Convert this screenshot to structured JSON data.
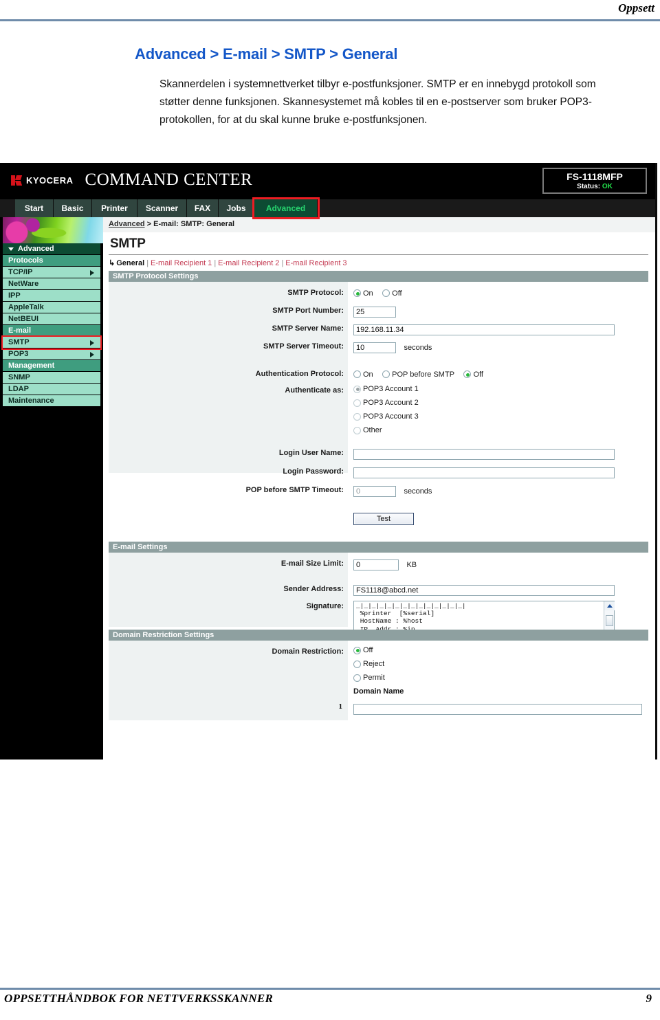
{
  "document": {
    "header_label": "Oppsett",
    "title": "Advanced > E-mail > SMTP > General",
    "body": "Skannerdelen i systemnettverket tilbyr e-postfunksjoner. SMTP er en innebygd protokoll som støtter denne funksjonen. Skannesystemet må kobles til en e-postserver som bruker POP3-protokollen, for at du skal kunne bruke e-postfunksjonen.",
    "footer_text": "OPPSETTHÅNDBOK FOR NETTVERKSSKANNER",
    "footer_page": "9"
  },
  "app": {
    "brand": "KYOCERA",
    "product": "COMMAND CENTER",
    "status": {
      "model": "FS-1118MFP",
      "label": "Status:",
      "value": "OK"
    },
    "tabs": [
      {
        "label": "Start",
        "active": false
      },
      {
        "label": "Basic",
        "active": false
      },
      {
        "label": "Printer",
        "active": false
      },
      {
        "label": "Scanner",
        "active": false
      },
      {
        "label": "FAX",
        "active": false
      },
      {
        "label": "Jobs",
        "active": false
      },
      {
        "label": "Advanced",
        "active": true
      }
    ],
    "breadcrumb": {
      "root": "Advanced",
      "separator": ">",
      "path": "E-mail: SMTP: General"
    },
    "colors": {
      "tab_bg": "#30453f",
      "tab_active_bg": "#0d4b33",
      "tab_active_text": "#27d46f",
      "highlight_outline": "#ee1c22",
      "sidebar_group": "#3f9d7f",
      "sidebar_item": "#9ddfc8",
      "section_bar": "#8ea0a0",
      "link": "#c43a52",
      "radio_on": "#27b83c"
    }
  },
  "sidebar": {
    "header": "Advanced",
    "items": [
      {
        "label": "Protocols",
        "type": "group"
      },
      {
        "label": "TCP/IP",
        "type": "item",
        "arrow": true,
        "selected": false
      },
      {
        "label": "NetWare",
        "type": "item",
        "arrow": false,
        "selected": false
      },
      {
        "label": "IPP",
        "type": "item",
        "arrow": false,
        "selected": false
      },
      {
        "label": "AppleTalk",
        "type": "item",
        "arrow": false,
        "selected": false
      },
      {
        "label": "NetBEUI",
        "type": "item",
        "arrow": false,
        "selected": false
      },
      {
        "label": "E-mail",
        "type": "group"
      },
      {
        "label": "SMTP",
        "type": "item",
        "arrow": true,
        "selected": true
      },
      {
        "label": "POP3",
        "type": "item",
        "arrow": true,
        "selected": false
      },
      {
        "label": "Management",
        "type": "group"
      },
      {
        "label": "SNMP",
        "type": "item",
        "arrow": false,
        "selected": false
      },
      {
        "label": "LDAP",
        "type": "item",
        "arrow": false,
        "selected": false
      },
      {
        "label": "Maintenance",
        "type": "item",
        "arrow": false,
        "selected": false
      }
    ]
  },
  "content": {
    "title": "SMTP",
    "subtabs": [
      {
        "label": "General",
        "current": true
      },
      {
        "label": "E-mail Recipient 1",
        "current": false
      },
      {
        "label": "E-mail Recipient 2",
        "current": false
      },
      {
        "label": "E-mail Recipient 3",
        "current": false
      }
    ],
    "sections": {
      "protocol": {
        "bar": "SMTP Protocol Settings",
        "smtp_protocol_label": "SMTP Protocol:",
        "smtp_protocol_options": [
          {
            "label": "On",
            "selected": true
          },
          {
            "label": "Off",
            "selected": false
          }
        ],
        "port_label": "SMTP Port Number:",
        "port_value": "25",
        "server_label": "SMTP Server Name:",
        "server_value": "192.168.11.34",
        "timeout_label": "SMTP Server Timeout:",
        "timeout_value": "10",
        "timeout_unit": "seconds",
        "auth_protocol_label": "Authentication Protocol:",
        "auth_protocol_options": [
          {
            "label": "On",
            "selected": false
          },
          {
            "label": "POP before SMTP",
            "selected": false
          },
          {
            "label": "Off",
            "selected": true
          }
        ],
        "authenticate_as_label": "Authenticate as:",
        "authenticate_as_options": [
          {
            "label": "POP3 Account 1",
            "selected": true
          },
          {
            "label": "POP3 Account 2",
            "selected": false
          },
          {
            "label": "POP3 Account 3",
            "selected": false
          },
          {
            "label": "Other",
            "selected": false
          }
        ],
        "login_user_label": "Login User Name:",
        "login_user_value": "",
        "login_pass_label": "Login Password:",
        "login_pass_value": "",
        "pop_timeout_label": "POP before SMTP Timeout:",
        "pop_timeout_value": "0",
        "pop_timeout_unit": "seconds",
        "test_button": "Test"
      },
      "email": {
        "bar": "E-mail Settings",
        "size_limit_label": "E-mail Size Limit:",
        "size_limit_value": "0",
        "size_limit_unit": "KB",
        "sender_label": "Sender Address:",
        "sender_value": "FS1118@abcd.net",
        "signature_label": "Signature:",
        "signature_value": "_|_|_|_|_|_|_|_|_|_|_|_|_|_|\n %printer  [%serial]\n HostName : %host\n IP  Addr : %ip\n_|_|_|_|_|_|_|_|_|_|_|_|_|"
      },
      "domain": {
        "bar": "Domain Restriction Settings",
        "restriction_label": "Domain Restriction:",
        "restriction_options": [
          {
            "label": "Off",
            "selected": true
          },
          {
            "label": "Reject",
            "selected": false
          },
          {
            "label": "Permit",
            "selected": false
          }
        ],
        "domain_name_header": "Domain Name",
        "rows": [
          {
            "index": "1",
            "value": ""
          }
        ]
      }
    }
  }
}
